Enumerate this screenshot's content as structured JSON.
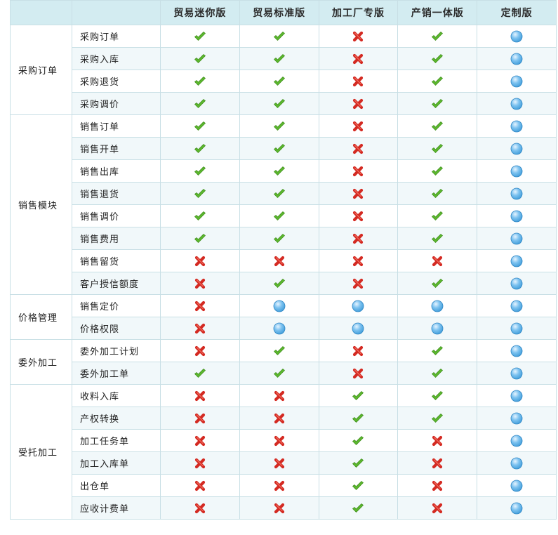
{
  "header": {
    "corner": "",
    "editions": [
      "贸易迷你版",
      "贸易标准版",
      "加工厂专版",
      "产销一体版",
      "定制版"
    ]
  },
  "icon_legend": {
    "yes": "green-check-icon",
    "no": "red-cross-icon",
    "custom": "blue-dot-icon"
  },
  "colors": {
    "header_bg": "#d3ecf1",
    "row_alt_bg": "#f1f8fa",
    "border": "#c8dfe5",
    "check": "#5cb82e",
    "cross": "#d42a22",
    "dot": "#3c9ad8"
  },
  "groups": [
    {
      "name": "采购订单",
      "rows": [
        {
          "feature": "采购订单",
          "support": [
            "yes",
            "yes",
            "no",
            "yes",
            "custom"
          ]
        },
        {
          "feature": "采购入库",
          "support": [
            "yes",
            "yes",
            "no",
            "yes",
            "custom"
          ]
        },
        {
          "feature": "采购退货",
          "support": [
            "yes",
            "yes",
            "no",
            "yes",
            "custom"
          ]
        },
        {
          "feature": "采购调价",
          "support": [
            "yes",
            "yes",
            "no",
            "yes",
            "custom"
          ]
        }
      ]
    },
    {
      "name": "销售模块",
      "rows": [
        {
          "feature": "销售订单",
          "support": [
            "yes",
            "yes",
            "no",
            "yes",
            "custom"
          ]
        },
        {
          "feature": "销售开单",
          "support": [
            "yes",
            "yes",
            "no",
            "yes",
            "custom"
          ]
        },
        {
          "feature": "销售出库",
          "support": [
            "yes",
            "yes",
            "no",
            "yes",
            "custom"
          ]
        },
        {
          "feature": "销售退货",
          "support": [
            "yes",
            "yes",
            "no",
            "yes",
            "custom"
          ]
        },
        {
          "feature": "销售调价",
          "support": [
            "yes",
            "yes",
            "no",
            "yes",
            "custom"
          ]
        },
        {
          "feature": "销售费用",
          "support": [
            "yes",
            "yes",
            "no",
            "yes",
            "custom"
          ]
        },
        {
          "feature": "销售留货",
          "support": [
            "no",
            "no",
            "no",
            "no",
            "custom"
          ]
        },
        {
          "feature": "客户授信额度",
          "support": [
            "no",
            "yes",
            "no",
            "yes",
            "custom"
          ]
        }
      ]
    },
    {
      "name": "价格管理",
      "rows": [
        {
          "feature": "销售定价",
          "support": [
            "no",
            "custom",
            "custom",
            "custom",
            "custom"
          ]
        },
        {
          "feature": "价格权限",
          "support": [
            "no",
            "custom",
            "custom",
            "custom",
            "custom"
          ]
        }
      ]
    },
    {
      "name": "委外加工",
      "rows": [
        {
          "feature": "委外加工计划",
          "support": [
            "no",
            "yes",
            "no",
            "yes",
            "custom"
          ]
        },
        {
          "feature": "委外加工单",
          "support": [
            "yes",
            "yes",
            "no",
            "yes",
            "custom"
          ]
        }
      ]
    },
    {
      "name": "受托加工",
      "rows": [
        {
          "feature": "收料入库",
          "support": [
            "no",
            "no",
            "yes",
            "yes",
            "custom"
          ]
        },
        {
          "feature": "产权转换",
          "support": [
            "no",
            "no",
            "yes",
            "yes",
            "custom"
          ]
        },
        {
          "feature": "加工任务单",
          "support": [
            "no",
            "no",
            "yes",
            "no",
            "custom"
          ]
        },
        {
          "feature": "加工入库单",
          "support": [
            "no",
            "no",
            "yes",
            "no",
            "custom"
          ]
        },
        {
          "feature": "出仓单",
          "support": [
            "no",
            "no",
            "yes",
            "no",
            "custom"
          ]
        },
        {
          "feature": "应收计费单",
          "support": [
            "no",
            "no",
            "yes",
            "no",
            "custom"
          ]
        }
      ]
    }
  ]
}
